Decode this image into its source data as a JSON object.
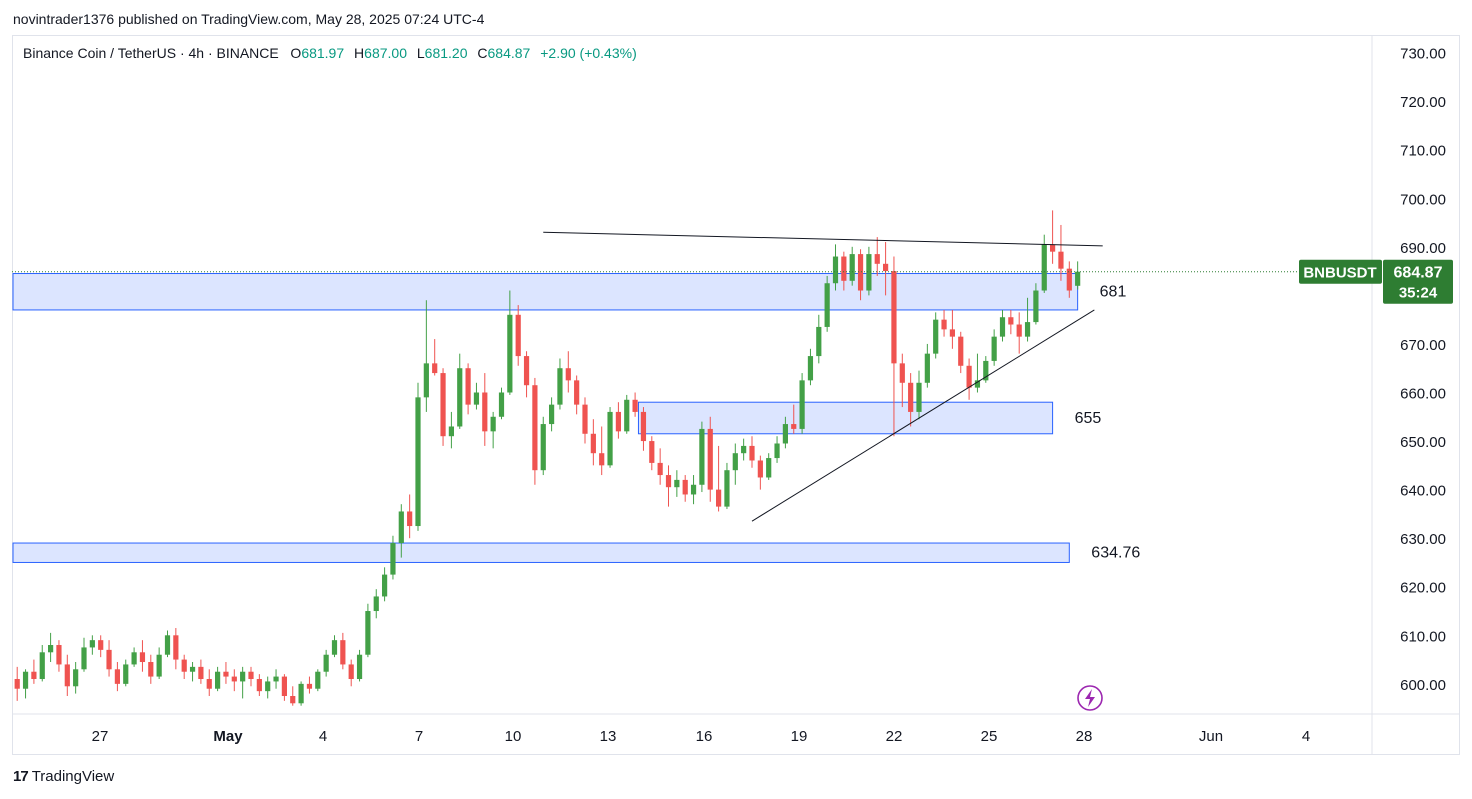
{
  "header": {
    "published_by": "novintrader1376 published on TradingView.com, May 28, 2025 07:24 UTC-4"
  },
  "legend": {
    "symbol_text": "Binance Coin / TetherUS · 4h · BINANCE",
    "open_label": "O",
    "open": "681.97",
    "high_label": "H",
    "high": "687.00",
    "low_label": "L",
    "low": "681.20",
    "close_label": "C",
    "close": "684.87",
    "change": "+2.90 (+0.43%)"
  },
  "price_tag": {
    "ticker": "BNBUSDT",
    "price": "684.87",
    "countdown": "35:24",
    "color": "#2e7d32"
  },
  "branding": {
    "logo_glyph": "17",
    "name": "TradingView"
  },
  "colors": {
    "up": "#43a047",
    "down": "#ef5350",
    "zone_fill": "#d6e0ff",
    "zone_border": "#2962ff"
  },
  "chart_data": {
    "type": "candlestick",
    "title": "",
    "xlabel": "",
    "ylabel": "",
    "ylim": [
      594,
      733
    ],
    "y_ticks": [
      "730.00",
      "720.00",
      "710.00",
      "700.00",
      "690.00",
      "680.00",
      "670.00",
      "660.00",
      "650.00",
      "640.00",
      "630.00",
      "620.00",
      "610.00",
      "600.00"
    ],
    "x_ticks": [
      "27",
      "May",
      "4",
      "7",
      "10",
      "13",
      "16",
      "19",
      "22",
      "25",
      "28",
      "Jun",
      "4"
    ],
    "x_tick_bold": [
      "May"
    ],
    "candles": [
      [
        601.0,
        603.5,
        596.5,
        599.0
      ],
      [
        599.0,
        603.0,
        597.0,
        602.5
      ],
      [
        602.5,
        605.0,
        600.0,
        601.0
      ],
      [
        601.0,
        608.0,
        600.5,
        606.5
      ],
      [
        606.5,
        610.5,
        604.5,
        608.0
      ],
      [
        608.0,
        609.0,
        602.5,
        604.0
      ],
      [
        604.0,
        606.0,
        597.5,
        599.5
      ],
      [
        599.5,
        604.5,
        598.0,
        603.0
      ],
      [
        603.0,
        609.5,
        602.5,
        607.5
      ],
      [
        607.5,
        610.0,
        606.0,
        609.0
      ],
      [
        609.0,
        610.0,
        605.5,
        607.0
      ],
      [
        607.0,
        609.0,
        601.5,
        603.0
      ],
      [
        603.0,
        604.5,
        598.5,
        600.0
      ],
      [
        600.0,
        605.0,
        599.5,
        604.0
      ],
      [
        604.0,
        607.5,
        603.5,
        606.5
      ],
      [
        606.5,
        609.0,
        602.5,
        604.5
      ],
      [
        604.5,
        606.0,
        600.0,
        601.5
      ],
      [
        601.5,
        607.5,
        601.0,
        606.0
      ],
      [
        606.0,
        611.0,
        605.5,
        610.0
      ],
      [
        610.0,
        611.5,
        603.0,
        605.0
      ],
      [
        605.0,
        606.0,
        601.0,
        602.5
      ],
      [
        602.5,
        604.5,
        600.5,
        603.5
      ],
      [
        603.5,
        605.0,
        600.0,
        601.0
      ],
      [
        601.0,
        603.0,
        597.5,
        599.0
      ],
      [
        599.0,
        603.5,
        598.5,
        602.5
      ],
      [
        602.5,
        604.5,
        600.0,
        601.5
      ],
      [
        601.5,
        603.0,
        598.5,
        600.5
      ],
      [
        600.5,
        603.5,
        597.0,
        602.5
      ],
      [
        602.5,
        603.5,
        599.5,
        601.0
      ],
      [
        601.0,
        602.0,
        597.5,
        598.5
      ],
      [
        598.5,
        601.5,
        597.0,
        600.5
      ],
      [
        600.5,
        603.0,
        599.0,
        601.5
      ],
      [
        601.5,
        602.0,
        596.5,
        597.5
      ],
      [
        597.5,
        599.5,
        595.5,
        596.0
      ],
      [
        596.0,
        600.5,
        595.5,
        600.0
      ],
      [
        600.0,
        601.5,
        598.0,
        599.0
      ],
      [
        599.0,
        603.0,
        598.5,
        602.5
      ],
      [
        602.5,
        607.0,
        601.5,
        606.0
      ],
      [
        606.0,
        610.0,
        605.5,
        609.0
      ],
      [
        609.0,
        610.5,
        603.0,
        604.0
      ],
      [
        604.0,
        605.0,
        599.5,
        601.0
      ],
      [
        601.0,
        607.0,
        600.5,
        606.0
      ],
      [
        606.0,
        616.5,
        605.5,
        615.0
      ],
      [
        615.0,
        619.5,
        613.5,
        618.0
      ],
      [
        618.0,
        624.0,
        617.0,
        622.5
      ],
      [
        622.5,
        630.5,
        621.5,
        629.0
      ],
      [
        629.0,
        637.0,
        626.0,
        635.5
      ],
      [
        635.5,
        639.0,
        630.0,
        632.5
      ],
      [
        632.5,
        662.0,
        631.5,
        659.0
      ],
      [
        659.0,
        679.0,
        656.0,
        666.0
      ],
      [
        666.0,
        671.0,
        663.5,
        664.0
      ],
      [
        664.0,
        665.0,
        649.0,
        651.0
      ],
      [
        651.0,
        656.0,
        648.5,
        653.0
      ],
      [
        653.0,
        668.0,
        652.5,
        665.0
      ],
      [
        665.0,
        666.0,
        655.5,
        657.5
      ],
      [
        657.5,
        662.0,
        656.5,
        660.0
      ],
      [
        660.0,
        664.0,
        649.0,
        652.0
      ],
      [
        652.0,
        656.0,
        648.5,
        655.0
      ],
      [
        655.0,
        661.0,
        654.5,
        660.0
      ],
      [
        660.0,
        681.0,
        659.5,
        676.0
      ],
      [
        676.0,
        678.0,
        665.5,
        667.5
      ],
      [
        667.5,
        668.5,
        659.0,
        661.5
      ],
      [
        661.5,
        663.0,
        641.0,
        644.0
      ],
      [
        644.0,
        655.0,
        643.0,
        653.5
      ],
      [
        653.5,
        659.0,
        652.0,
        657.5
      ],
      [
        657.5,
        667.0,
        656.5,
        665.0
      ],
      [
        665.0,
        668.5,
        660.0,
        662.5
      ],
      [
        662.5,
        663.5,
        655.5,
        657.5
      ],
      [
        657.5,
        659.0,
        649.5,
        651.5
      ],
      [
        651.5,
        654.5,
        645.0,
        647.5
      ],
      [
        647.5,
        653.0,
        643.0,
        645.0
      ],
      [
        645.0,
        657.0,
        644.5,
        656.0
      ],
      [
        656.0,
        658.0,
        650.5,
        652.0
      ],
      [
        652.0,
        659.5,
        651.5,
        658.5
      ],
      [
        658.5,
        660.0,
        655.0,
        656.0
      ],
      [
        656.0,
        657.0,
        648.0,
        650.0
      ],
      [
        650.0,
        651.0,
        644.0,
        645.5
      ],
      [
        645.5,
        648.5,
        641.0,
        643.0
      ],
      [
        643.0,
        645.0,
        636.5,
        640.5
      ],
      [
        640.5,
        644.0,
        638.5,
        642.0
      ],
      [
        642.0,
        643.0,
        637.5,
        639.0
      ],
      [
        639.0,
        643.0,
        637.0,
        641.0
      ],
      [
        641.0,
        654.0,
        639.5,
        652.5
      ],
      [
        652.5,
        655.0,
        637.5,
        640.0
      ],
      [
        640.0,
        649.0,
        635.5,
        636.5
      ],
      [
        636.5,
        645.5,
        636.0,
        644.0
      ],
      [
        644.0,
        649.5,
        641.0,
        647.5
      ],
      [
        647.5,
        650.5,
        646.0,
        649.0
      ],
      [
        649.0,
        651.0,
        644.5,
        646.0
      ],
      [
        646.0,
        647.0,
        640.0,
        642.5
      ],
      [
        642.5,
        647.5,
        642.0,
        646.5
      ],
      [
        646.5,
        651.0,
        645.5,
        649.5
      ],
      [
        649.5,
        655.0,
        648.5,
        653.5
      ],
      [
        653.5,
        657.5,
        651.5,
        652.5
      ],
      [
        652.5,
        664.0,
        651.5,
        662.5
      ],
      [
        662.5,
        669.0,
        661.5,
        667.5
      ],
      [
        667.5,
        676.0,
        666.0,
        673.5
      ],
      [
        673.5,
        684.0,
        672.5,
        682.5
      ],
      [
        682.5,
        690.5,
        681.0,
        688.0
      ],
      [
        688.0,
        689.0,
        681.0,
        683.0
      ],
      [
        683.0,
        690.0,
        682.0,
        688.5
      ],
      [
        688.5,
        689.5,
        679.0,
        681.0
      ],
      [
        681.0,
        690.0,
        680.0,
        688.5
      ],
      [
        688.5,
        692.0,
        684.0,
        686.5
      ],
      [
        686.5,
        691.0,
        680.0,
        685.0
      ],
      [
        685.0,
        688.0,
        651.0,
        666.0
      ],
      [
        666.0,
        668.0,
        657.0,
        662.0
      ],
      [
        662.0,
        664.0,
        653.0,
        656.0
      ],
      [
        656.0,
        664.5,
        654.5,
        662.0
      ],
      [
        662.0,
        670.0,
        661.0,
        668.0
      ],
      [
        668.0,
        676.5,
        667.0,
        675.0
      ],
      [
        675.0,
        677.0,
        671.5,
        673.0
      ],
      [
        673.0,
        677.0,
        669.0,
        671.5
      ],
      [
        671.5,
        672.5,
        664.0,
        665.5
      ],
      [
        665.5,
        667.0,
        658.5,
        661.0
      ],
      [
        661.0,
        668.0,
        660.0,
        662.5
      ],
      [
        662.5,
        667.5,
        662.0,
        666.5
      ],
      [
        666.5,
        673.0,
        665.5,
        671.5
      ],
      [
        671.5,
        677.0,
        670.5,
        675.5
      ],
      [
        675.5,
        677.0,
        672.0,
        674.0
      ],
      [
        674.0,
        676.5,
        668.0,
        671.5
      ],
      [
        671.5,
        679.5,
        670.5,
        674.5
      ],
      [
        674.5,
        682.5,
        674.0,
        681.0
      ],
      [
        681.0,
        692.5,
        680.5,
        690.5
      ],
      [
        690.5,
        697.5,
        686.5,
        689.0
      ],
      [
        689.0,
        694.5,
        683.0,
        685.5
      ],
      [
        685.5,
        687.0,
        679.5,
        681.0
      ],
      [
        681.97,
        687.0,
        681.2,
        684.87
      ]
    ],
    "zones": [
      {
        "label": "681",
        "top": 684.5,
        "bottom": 677.0,
        "x_start_bar": 0,
        "x_end_bar": 127
      },
      {
        "label": "655",
        "top": 658.0,
        "bottom": 651.5,
        "x_start_bar": 75,
        "x_end_bar": 124
      },
      {
        "label": "634.76",
        "top": 629.0,
        "bottom": 625.0,
        "x_start_bar": 0,
        "x_end_bar": 126
      }
    ],
    "trendlines": [
      {
        "from": {
          "bar": 63,
          "price": 693.0
        },
        "to": {
          "bar": 130,
          "price": 690.2
        }
      },
      {
        "from": {
          "bar": 88,
          "price": 633.5
        },
        "to": {
          "bar": 129,
          "price": 677.0
        }
      }
    ],
    "last_price": 684.87,
    "grid": false,
    "legend_position": "top-left"
  }
}
